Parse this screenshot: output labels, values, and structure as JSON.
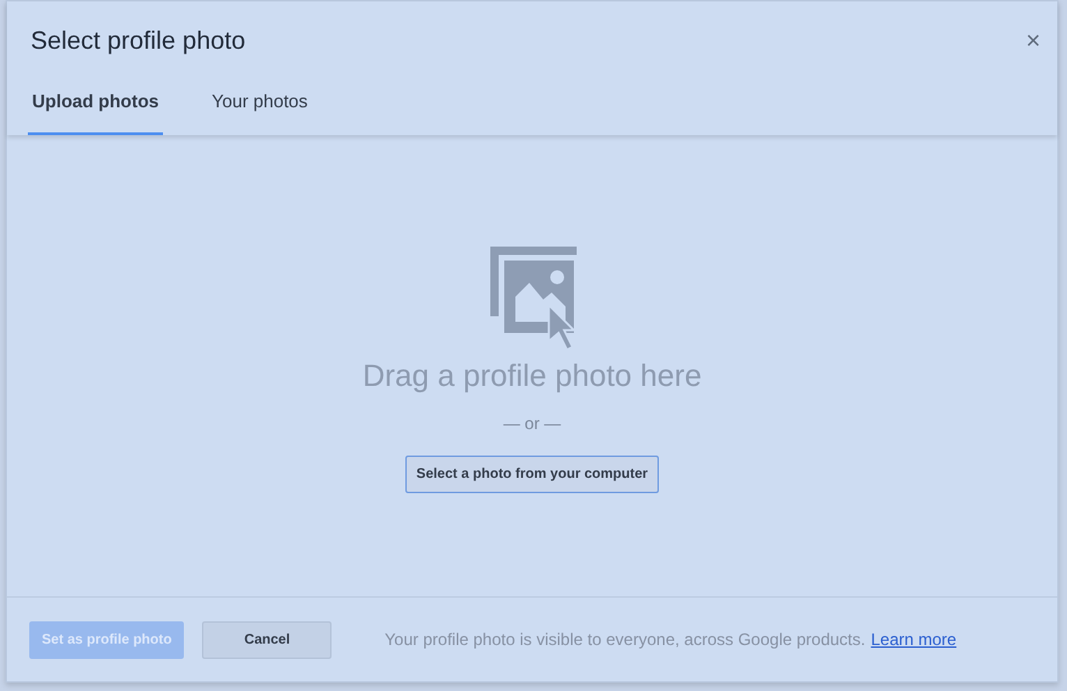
{
  "dialog": {
    "title": "Select profile photo",
    "close": "×"
  },
  "tabs": [
    {
      "label": "Upload photos",
      "selected": true
    },
    {
      "label": "Your photos",
      "selected": false
    }
  ],
  "dropzone": {
    "heading": "Drag a profile photo here",
    "separator": "— or —",
    "button": "Select a photo from your computer"
  },
  "footer": {
    "buttons": [
      {
        "label": "Set as profile photo",
        "kind": "primary",
        "disabled": true
      },
      {
        "label": "Cancel",
        "kind": "secondary",
        "disabled": false
      }
    ],
    "note": "Your profile photo is visible to everyone, across Google products.",
    "link": "Learn more"
  }
}
